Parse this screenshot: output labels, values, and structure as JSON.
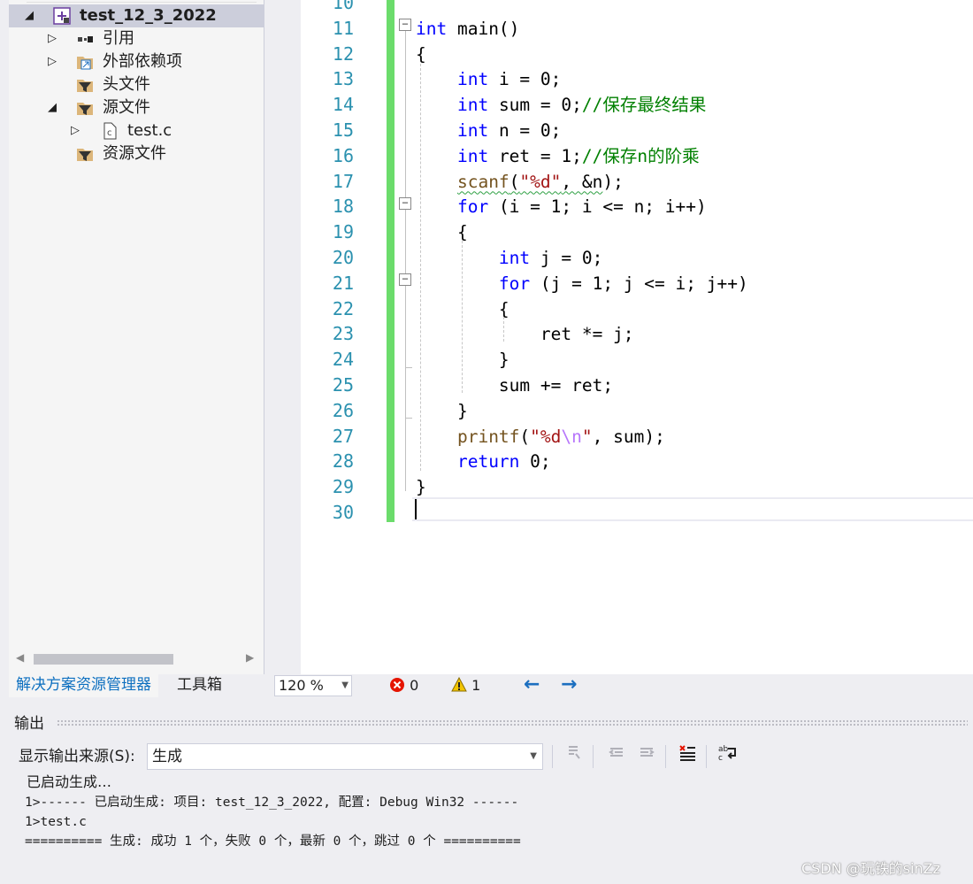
{
  "solution_explorer": {
    "items": [
      {
        "label": "test_12_3_2022",
        "arrow": "◢"
      },
      {
        "label": "引用",
        "arrow": "▷"
      },
      {
        "label": "外部依赖项",
        "arrow": "▷"
      },
      {
        "label": "头文件",
        "arrow": ""
      },
      {
        "label": "源文件",
        "arrow": "◢"
      },
      {
        "label": "test.c",
        "arrow": "▷"
      },
      {
        "label": "资源文件",
        "arrow": ""
      }
    ],
    "tabs": [
      "解决方案资源管理器",
      "工具箱"
    ]
  },
  "editor": {
    "line_numbers": [
      "10",
      "11",
      "12",
      "13",
      "14",
      "15",
      "16",
      "17",
      "18",
      "19",
      "20",
      "21",
      "22",
      "23",
      "24",
      "25",
      "26",
      "27",
      "28",
      "29",
      "30"
    ],
    "lines": [
      [
        {
          "t": "int",
          "c": "kw"
        },
        {
          "t": " main()"
        }
      ],
      [
        {
          "t": "{"
        }
      ],
      [
        {
          "t": "    "
        },
        {
          "t": "int",
          "c": "kw"
        },
        {
          "t": " i = 0;"
        }
      ],
      [
        {
          "t": "    "
        },
        {
          "t": "int",
          "c": "kw"
        },
        {
          "t": " sum = 0;"
        },
        {
          "t": "//保存最终结果",
          "c": "cm"
        }
      ],
      [
        {
          "t": "    "
        },
        {
          "t": "int",
          "c": "kw"
        },
        {
          "t": " n = 0;"
        }
      ],
      [
        {
          "t": "    "
        },
        {
          "t": "int",
          "c": "kw"
        },
        {
          "t": " ret = 1;"
        },
        {
          "t": "//保存n的阶乘",
          "c": "cm"
        }
      ],
      [
        {
          "t": "    "
        },
        {
          "t": "scanf",
          "c": "fx",
          "sq": true
        },
        {
          "t": "(",
          "sq": true
        },
        {
          "t": "\"%d\"",
          "c": "st",
          "sq": true
        },
        {
          "t": ", &n",
          "sq": true
        },
        {
          "t": ");"
        }
      ],
      [
        {
          "t": "    "
        },
        {
          "t": "for",
          "c": "kw"
        },
        {
          "t": " (i = 1; i <= n; i++)"
        }
      ],
      [
        {
          "t": "    {"
        }
      ],
      [
        {
          "t": "        "
        },
        {
          "t": "int",
          "c": "kw"
        },
        {
          "t": " j = 0;"
        }
      ],
      [
        {
          "t": "        "
        },
        {
          "t": "for",
          "c": "kw"
        },
        {
          "t": " (j = 1; j <= i; j++)"
        }
      ],
      [
        {
          "t": "        {"
        }
      ],
      [
        {
          "t": "            ret *= j;"
        }
      ],
      [
        {
          "t": "        }"
        }
      ],
      [
        {
          "t": "        sum += ret;"
        }
      ],
      [
        {
          "t": "    }"
        }
      ],
      [
        {
          "t": "    "
        },
        {
          "t": "printf",
          "c": "fx"
        },
        {
          "t": "("
        },
        {
          "t": "\"%d",
          "c": "st"
        },
        {
          "t": "\\n",
          "c": "es"
        },
        {
          "t": "\"",
          "c": "st"
        },
        {
          "t": ", sum);"
        }
      ],
      [
        {
          "t": "    "
        },
        {
          "t": "return",
          "c": "kw"
        },
        {
          "t": " 0;"
        }
      ],
      [
        {
          "t": "}"
        }
      ],
      [
        {
          "t": ""
        }
      ]
    ],
    "fold_markers": [
      "−",
      "−",
      "−"
    ]
  },
  "status_bar": {
    "zoom": "120 %",
    "errors": "0",
    "warnings": "1",
    "nav_back": "←",
    "nav_forward": "→"
  },
  "output": {
    "title": "输出",
    "source_label": "显示输出来源(S):",
    "source_value": "生成",
    "lines": [
      "已启动生成…",
      "1>------ 已启动生成: 项目: test_12_3_2022, 配置: Debug Win32 ------",
      "1>test.c",
      "========== 生成: 成功 1 个，失败 0 个，最新 0 个，跳过 0 个 =========="
    ]
  },
  "watermark": "CSDN @玩铁的sinZz",
  "icons": {
    "project": "project-icon",
    "references": "references-icon",
    "external_deps": "external-deps-icon",
    "folder": "filter-folder-icon",
    "file": "c-file-icon",
    "error": "error-icon",
    "warning": "warning-icon"
  },
  "colors": {
    "keyword": "#0000ff",
    "comment": "#008000",
    "string": "#a31515",
    "line_number": "#2b91af",
    "change_bar": "#6bdc6b",
    "accent": "#0e70c0"
  }
}
